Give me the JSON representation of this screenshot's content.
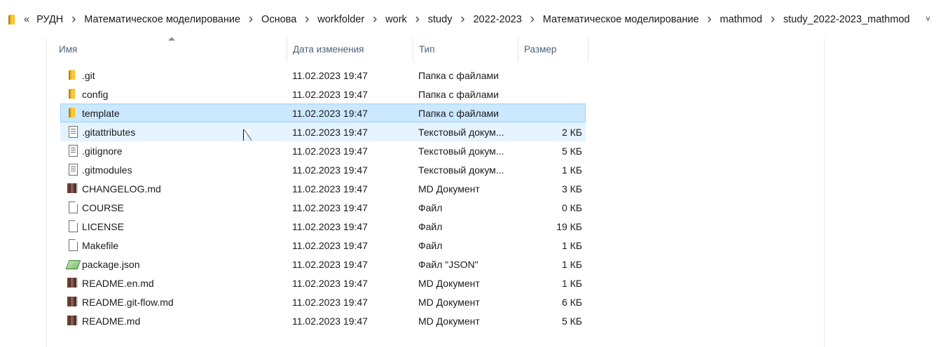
{
  "address_bar": {
    "overflow_label": "«",
    "crumbs": [
      "РУДН",
      "Математическое моделирование",
      "Основа",
      "workfolder",
      "work",
      "study",
      "2022-2023",
      "Математическое моделирование",
      "mathmod",
      "study_2022-2023_mathmod"
    ]
  },
  "columns": {
    "name": "Имя",
    "date": "Дата изменения",
    "type": "Тип",
    "size": "Размер"
  },
  "files": [
    {
      "name": ".git",
      "date": "11.02.2023 19:47",
      "type": "Папка с файлами",
      "size": "",
      "icon": "folder-icon"
    },
    {
      "name": "config",
      "date": "11.02.2023 19:47",
      "type": "Папка с файлами",
      "size": "",
      "icon": "folder-icon"
    },
    {
      "name": "template",
      "date": "11.02.2023 19:47",
      "type": "Папка с файлами",
      "size": "",
      "icon": "folder-icon"
    },
    {
      "name": ".gitattributes",
      "date": "11.02.2023 19:47",
      "type": "Текстовый докум...",
      "size": "2 КБ",
      "icon": "text-document-icon"
    },
    {
      "name": ".gitignore",
      "date": "11.02.2023 19:47",
      "type": "Текстовый докум...",
      "size": "5 КБ",
      "icon": "text-document-icon"
    },
    {
      "name": ".gitmodules",
      "date": "11.02.2023 19:47",
      "type": "Текстовый докум...",
      "size": "1 КБ",
      "icon": "text-document-icon"
    },
    {
      "name": "CHANGELOG.md",
      "date": "11.02.2023 19:47",
      "type": "MD Документ",
      "size": "3 КБ",
      "icon": "markdown-document-icon"
    },
    {
      "name": "COURSE",
      "date": "11.02.2023 19:47",
      "type": "Файл",
      "size": "0 КБ",
      "icon": "file-icon"
    },
    {
      "name": "LICENSE",
      "date": "11.02.2023 19:47",
      "type": "Файл",
      "size": "19 КБ",
      "icon": "file-icon"
    },
    {
      "name": "Makefile",
      "date": "11.02.2023 19:47",
      "type": "Файл",
      "size": "1 КБ",
      "icon": "file-icon"
    },
    {
      "name": "package.json",
      "date": "11.02.2023 19:47",
      "type": "Файл \"JSON\"",
      "size": "1 КБ",
      "icon": "json-file-icon"
    },
    {
      "name": "README.en.md",
      "date": "11.02.2023 19:47",
      "type": "MD Документ",
      "size": "1 КБ",
      "icon": "markdown-document-icon"
    },
    {
      "name": "README.git-flow.md",
      "date": "11.02.2023 19:47",
      "type": "MD Документ",
      "size": "6 КБ",
      "icon": "markdown-document-icon"
    },
    {
      "name": "README.md",
      "date": "11.02.2023 19:47",
      "type": "MD Документ",
      "size": "5 КБ",
      "icon": "markdown-document-icon"
    }
  ],
  "state": {
    "selected_row": "template",
    "hovered_row": ".gitattributes"
  },
  "colors": {
    "selection": "#cce8ff",
    "hover": "#e5f3ff",
    "header_text": "#4c607a"
  }
}
